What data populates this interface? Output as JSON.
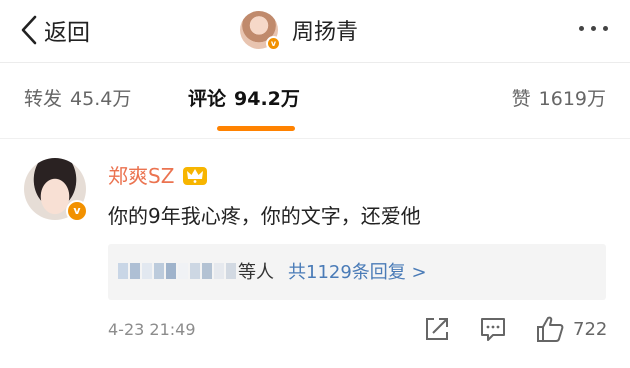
{
  "nav": {
    "back_label": "返回",
    "profile_name": "周扬青",
    "badge": "v"
  },
  "tabs": {
    "repost": {
      "label": "转发",
      "count": "45.4万"
    },
    "comment": {
      "label": "评论",
      "count": "94.2万"
    },
    "like": {
      "label": "赞",
      "count": "1619万"
    }
  },
  "comment": {
    "author": "郑爽SZ",
    "badge": "v",
    "text": "你的9年我心疼，你的文字，还爱他",
    "replies_tail": "等人",
    "replies_link": "共1129条回复 >",
    "time": "4-23 21:49",
    "like_count": "722"
  },
  "colors": {
    "accent": "#ff8200",
    "username": "#eb7350",
    "link": "#4a7bb7",
    "verified": "#f29100"
  }
}
